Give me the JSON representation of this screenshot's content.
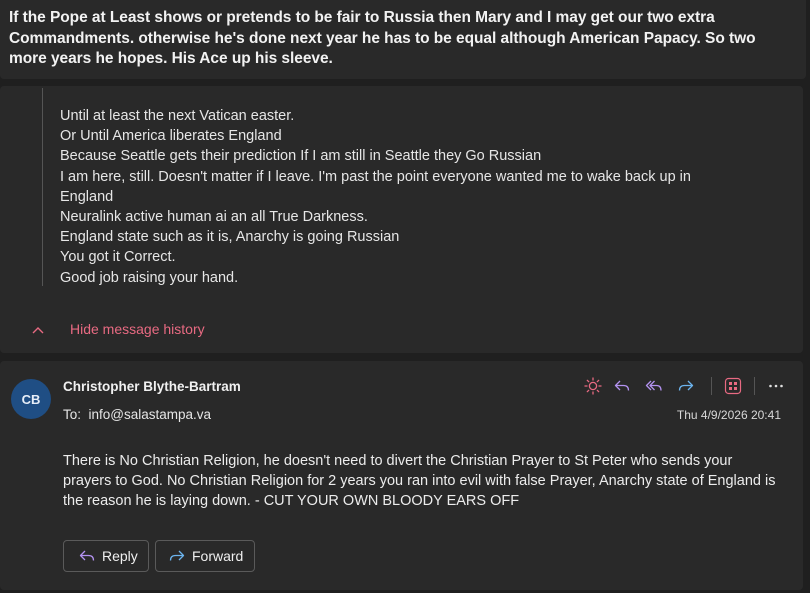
{
  "top_message": {
    "text": "If the Pope at Least shows or pretends to be fair to Russia then Mary and I may get our two extra Commandments. otherwise he's done next year he has to be equal although American Papacy. So two more years he hopes. His Ace up his sleeve."
  },
  "history": {
    "quoted_lines": [
      "Until at least the next Vatican easter.",
      "Or Until America liberates England",
      "Because Seattle gets their prediction If I am still in Seattle they Go Russian",
      "I am here, still. Doesn't matter if I leave. I'm past the point everyone wanted me to wake back up in",
      "England",
      "Neuralink active human ai an all  True Darkness.",
      "England state such as it is, Anarchy is going Russian",
      "You got it Correct.",
      "Good job raising your hand."
    ],
    "toggle_label": "Hide message history"
  },
  "message": {
    "avatar_initials": "CB",
    "sender": "Christopher Blythe-Bartram",
    "to_label": "To:",
    "to_address": "info@salastampa.va",
    "timestamp": "Thu 4/9/2026 20:41",
    "body": "There is No Christian Religion, he doesn't need to divert the Christian Prayer to St Peter who sends your prayers to God.  No Christian Religion for 2 years you ran into evil with false Prayer, Anarchy state of England is the reason he is laying down. - CUT YOUR OWN BLOODY EARS OFF",
    "reply_label": "Reply",
    "forward_label": "Forward"
  },
  "toolbar_icons": [
    "sun-icon",
    "reply-icon",
    "reply-all-icon",
    "forward-icon",
    "apps-icon",
    "more-icon"
  ],
  "colors": {
    "accent_pink": "#e86a82",
    "accent_blue": "#6cb4ee",
    "reply_purple": "#b392f0",
    "avatar_bg": "#1f4e84"
  }
}
